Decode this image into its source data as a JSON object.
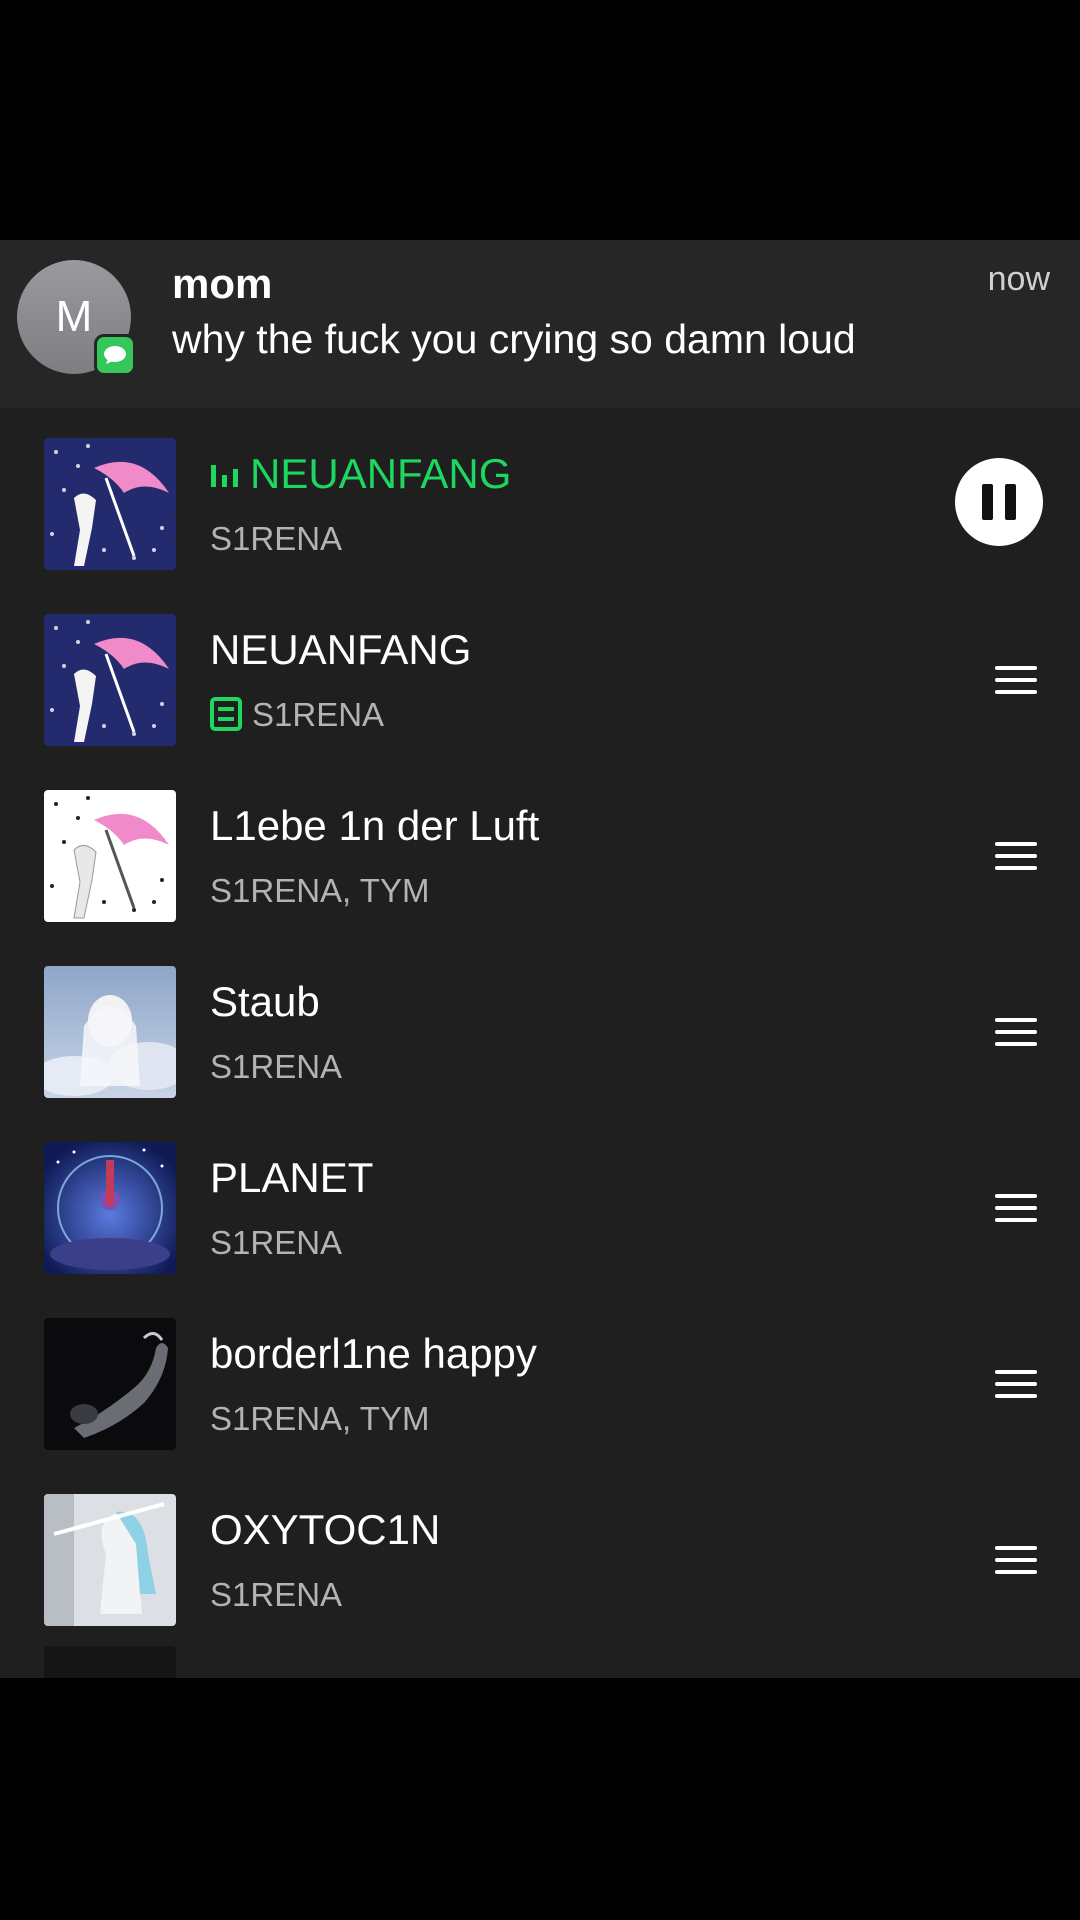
{
  "notification": {
    "avatar_initial": "M",
    "sender": "mom",
    "message": "why the fuck you crying so damn loud",
    "time": "now"
  },
  "queue": {
    "now_playing": {
      "title": "NEUANFANG",
      "artist": "S1RENA",
      "accent_color": "#1ed760"
    },
    "tracks": [
      {
        "title": "NEUANFANG",
        "artist": "S1RENA",
        "downloaded": true
      },
      {
        "title": "L1ebe 1n der Luft",
        "artist": "S1RENA, TYM"
      },
      {
        "title": "Staub",
        "artist": "S1RENA"
      },
      {
        "title": "PLANET",
        "artist": "S1RENA"
      },
      {
        "title": "borderl1ne happy",
        "artist": "S1RENA, TYM"
      },
      {
        "title": "OXYTOC1N",
        "artist": "S1RENA"
      }
    ]
  }
}
